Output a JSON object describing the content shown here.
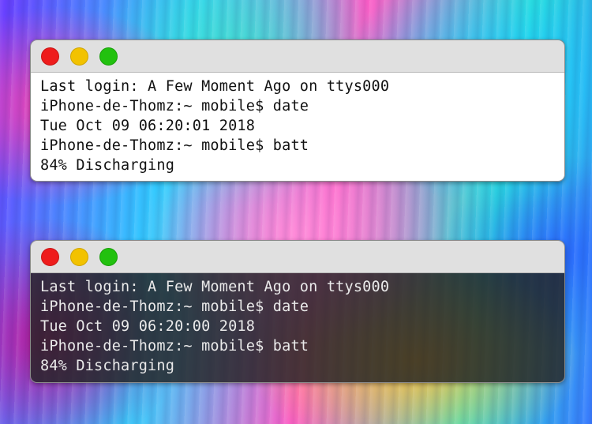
{
  "windows": [
    {
      "theme": "light",
      "lines": [
        "Last login: A Few Moment Ago on ttys000",
        "iPhone-de-Thomz:~ mobile$ date",
        "Tue Oct 09 06:20:01 2018",
        "iPhone-de-Thomz:~ mobile$ batt",
        "84% Discharging"
      ]
    },
    {
      "theme": "dark",
      "lines": [
        "Last login: A Few Moment Ago on ttys000",
        "iPhone-de-Thomz:~ mobile$ date",
        "Tue Oct 09 06:20:00 2018",
        "iPhone-de-Thomz:~ mobile$ batt",
        "84% Discharging"
      ]
    }
  ],
  "colors": {
    "close": "#ee1c1c",
    "minimize": "#f2c200",
    "maximize": "#22c10f"
  }
}
